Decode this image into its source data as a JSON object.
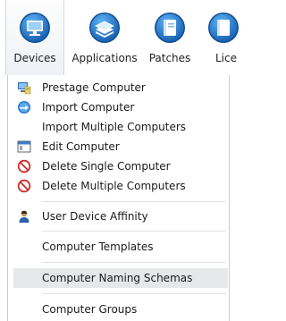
{
  "ribbon": {
    "buttons": [
      {
        "label": "Devices",
        "icon": "monitor-icon",
        "active": true
      },
      {
        "label": "Applications",
        "icon": "stacked-apps-icon",
        "active": false
      },
      {
        "label": "Patches",
        "icon": "book-icon",
        "active": false
      },
      {
        "label": "Lice",
        "icon": "license-book-icon",
        "active": false
      }
    ]
  },
  "menu": {
    "items": [
      {
        "label": "Prestage Computer",
        "icon": "prestage-computer-icon"
      },
      {
        "label": "Import Computer",
        "icon": "import-circle-icon"
      },
      {
        "label": "Import Multiple Computers",
        "icon": ""
      },
      {
        "label": "Edit Computer",
        "icon": "window-edit-icon"
      },
      {
        "label": "Delete Single Computer",
        "icon": "no-entry-icon"
      },
      {
        "label": "Delete Multiple Computers",
        "icon": "no-entry-icon"
      },
      {
        "label": "User Device Affinity",
        "icon": "user-icon"
      },
      {
        "label": "Computer Templates",
        "icon": ""
      },
      {
        "label": "Computer Naming Schemas",
        "icon": "",
        "highlighted": true
      },
      {
        "label": "Computer Groups",
        "icon": ""
      }
    ]
  },
  "colors": {
    "icon_blue_outer": "#1e6fc2",
    "icon_blue_inner": "#3d9be9",
    "highlight": "#e6e7e9",
    "delete_red": "#d12a2a"
  }
}
